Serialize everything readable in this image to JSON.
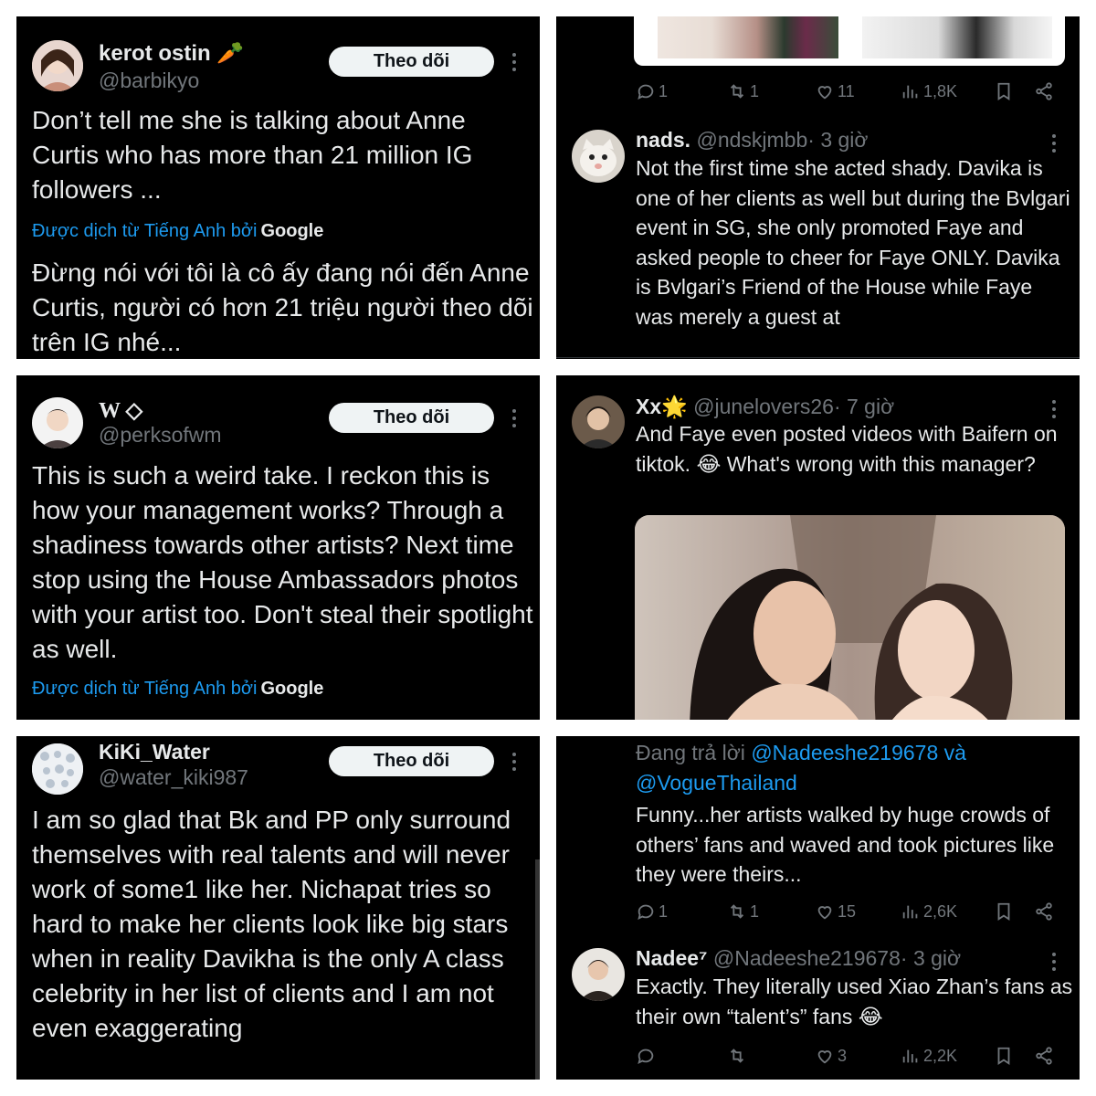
{
  "colors": {
    "bg": "#000000",
    "text": "#e7e9ea",
    "muted": "#71767b",
    "link": "#1d9bf0",
    "button": "#eff3f4"
  },
  "panel1": {
    "name": "kerot ostin 🥕",
    "handle": "@barbikyo",
    "follow_label": "Theo dõi",
    "text": "Don’t tell me she is talking about Anne Curtis who has more than 21 million IG followers ...",
    "translate_label": "Được dịch từ Tiếng Anh bởi",
    "translate_brand": "Google",
    "translation": "Đừng nói với tôi là cô ấy đang nói đến Anne Curtis, người có hơn 21 triệu người theo dõi trên IG nhé..."
  },
  "panel2": {
    "actions": {
      "replies": "1",
      "reposts": "1",
      "likes": "11",
      "views": "1,8K"
    },
    "reply": {
      "name": "nads.",
      "handle": "@ndskjmbb",
      "time": "· 3 giờ",
      "text": "Not the first time she acted shady. Davika is one of her clients as well but during the Bvlgari event in SG, she only promoted Faye and asked people to cheer for Faye ONLY. Davika is Bvlgari’s Friend of the House while Faye was merely a guest at"
    }
  },
  "panel3": {
    "name": "W ◇",
    "handle": "@perksofwm",
    "follow_label": "Theo dõi",
    "text": "This is such a weird take. I reckon this is how your management works? Through a shadiness towards other artists? Next time stop using the House Ambassadors photos with your artist too. Don't steal their spotlight as well.",
    "translate_label": "Được dịch từ Tiếng Anh bởi",
    "translate_brand": "Google"
  },
  "panel4": {
    "name": "Xx🌟",
    "handle": "@junelovers26",
    "time": "· 7 giờ",
    "text": "And Faye even posted videos with Baifern on tiktok. 😂 What's wrong with this manager?"
  },
  "panel5": {
    "name": "KiKi_Water",
    "handle": "@water_kiki987",
    "follow_label": "Theo dõi",
    "text": "I am so glad that Bk and PP only surround themselves with real talents and will never work of some1 like her. Nichapat tries so hard to make her clients look like big stars when in reality Davikha is the only A class celebrity in her list of clients and I am not even exaggerating"
  },
  "panel6": {
    "replying_prefix": "Đang trả lời",
    "replying_user1": "@Nadeeshe219678",
    "replying_and": "và",
    "replying_user2": "@VogueThailand",
    "text": "Funny...her artists walked by huge crowds of others’ fans and waved and took pictures like they were theirs...",
    "actions": {
      "replies": "1",
      "reposts": "1",
      "likes": "15",
      "views": "2,6K"
    },
    "reply": {
      "name": "Nadee⁷",
      "handle": "@Nadeeshe219678",
      "time": "· 3 giờ",
      "text": "Exactly. They literally used Xiao Zhan’s fans as their own “talent’s” fans 😂",
      "actions": {
        "likes": "3",
        "views": "2,2K"
      }
    }
  }
}
